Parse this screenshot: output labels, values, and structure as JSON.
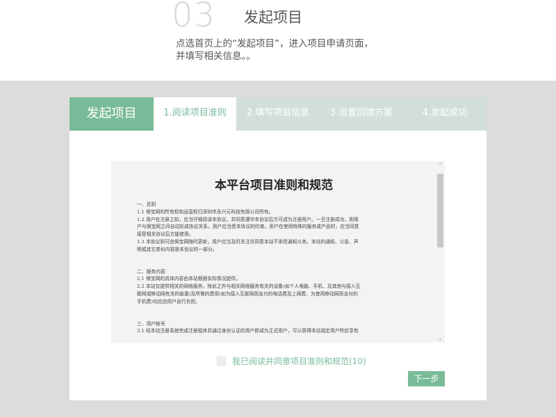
{
  "header": {
    "step_number": "03",
    "step_title": "发起项目",
    "description_line1": "点选首页上的“发起项目”，进入项目申请页面，",
    "description_line2": "并填写相关信息。。"
  },
  "wizard": {
    "title": "发起项目",
    "tabs": [
      {
        "label": "1.阅读项目准则",
        "active": true
      },
      {
        "label": "2.填写项目信息",
        "active": false
      },
      {
        "label": "3.设置回馈方案",
        "active": false
      },
      {
        "label": "4.发起成功",
        "active": false
      }
    ]
  },
  "agreement": {
    "title": "本平台项目准则和规范",
    "sections": [
      {
        "lines": [
          "一、总则",
          "1.1 保宝网的所有权和运营权归深圳市永兴元科技有限公司所有。",
          "1.2 用户在注册之前，应当仔细阅读本协议，并同意遵守本协议后方可成为注册用户。一旦注册成功，则用",
          "户与保宝网之间自动形成协议关系，用户应当受本协议的约束。用户在使用特殊的服务或产品时，应当同意",
          "接受相关协议后方能使用。",
          "1.3 本协议则可由保宝网随时更新，用户应当及时关注并同意本站不承担通知义务。本站的通知、公告、声",
          "明或其它类似内容是本协议的一部分。"
        ]
      },
      {
        "lines": [
          "二、服务内容",
          "2.1 保宝网的具体内容由本站根据实际情况提供。",
          "2.2 本站仅提供相关的网络服务，除此之外与相关网络服务有关的设备(如个人电脑、手机、及其他与接入互",
          "联网或移动网有关的装置)及所需的费用(如为接入互联网而支付的电话费及上网费、为使用移动网而支付的",
          "手机费)均应由用户自行负担。"
        ]
      },
      {
        "lines": [
          "三、用户帐号",
          "3.1 经本站注册系统完成注册程序并通过身份认证的用户即成为正式用户，可以获得本站规定用户所应享有"
        ]
      }
    ]
  },
  "consent": {
    "label": "我已阅读并同意项目准则和规范(10)",
    "checked": false
  },
  "next_button": {
    "label": "下一步"
  },
  "colors": {
    "accent": "#79bb98",
    "tab_bar": "#d2dfd8",
    "background": "#dcdcdc",
    "agreement_bg": "#f3f3f3"
  },
  "icons": {
    "scroll_up": "chevron-up-icon",
    "scroll_down": "chevron-down-icon"
  }
}
